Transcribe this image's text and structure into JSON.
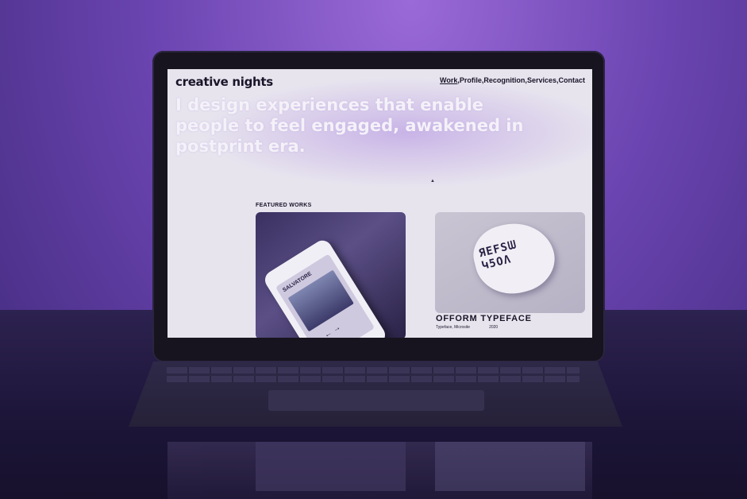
{
  "site": {
    "brand": "creative nights",
    "nav": {
      "work": "Work",
      "profile": "Profile",
      "recognition": "Recognition",
      "services": "Services",
      "contact": "Contact",
      "separator": ", "
    },
    "hero_line1": "I design experiences that enable",
    "hero_line2": "people to feel engaged, awakened in",
    "hero_line3": "postprint era."
  },
  "featured": {
    "title": "FEATURED WORKS",
    "work1": {
      "app_title": "SALVATORE",
      "arrows": "←  →"
    },
    "work2": {
      "title": "OFFORM TYPEFACE",
      "category": "Typeface, Microsite",
      "year": "2020",
      "glyphs": "ЯEFSᗯ\nԿ5ΟΛ"
    }
  },
  "colors": {
    "background": "#6a44b0",
    "screen": "#e7e4ee",
    "text_dark": "#1a1528",
    "hero_text": "#f4f1f8"
  }
}
